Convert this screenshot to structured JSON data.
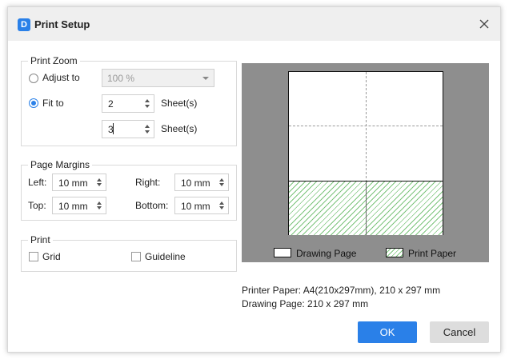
{
  "dialog": {
    "title": "Print Setup",
    "app_icon": "D",
    "close_icon": "close-icon"
  },
  "print_zoom": {
    "title": "Print Zoom",
    "adjust_to_label": "Adjust to",
    "adjust_to_value": "100 %",
    "adjust_to_selected": false,
    "fit_to_label": "Fit to",
    "fit_to_selected": true,
    "fit_width_value": "2",
    "fit_height_value": "3",
    "sheets_label_1": "Sheet(s)",
    "sheets_label_2": "Sheet(s)"
  },
  "page_margins": {
    "title": "Page Margins",
    "left_label": "Left:",
    "left_value": "10 mm",
    "right_label": "Right:",
    "right_value": "10 mm",
    "top_label": "Top:",
    "top_value": "10 mm",
    "bottom_label": "Bottom:",
    "bottom_value": "10 mm"
  },
  "print": {
    "title": "Print",
    "grid_label": "Grid",
    "grid_checked": false,
    "guideline_label": "Guideline",
    "guideline_checked": false
  },
  "preview": {
    "legend_drawing_page": "Drawing Page",
    "legend_print_paper": "Print Paper",
    "background_color": "#8e8e8e",
    "hatch_color": "#7cc47c"
  },
  "info": {
    "printer_paper": "Printer Paper: A4(210x297mm), 210 x 297 mm",
    "drawing_page": "Drawing Page: 210 x 297 mm"
  },
  "buttons": {
    "ok_label": "OK",
    "cancel_label": "Cancel",
    "accent_color": "#2a80e8"
  }
}
